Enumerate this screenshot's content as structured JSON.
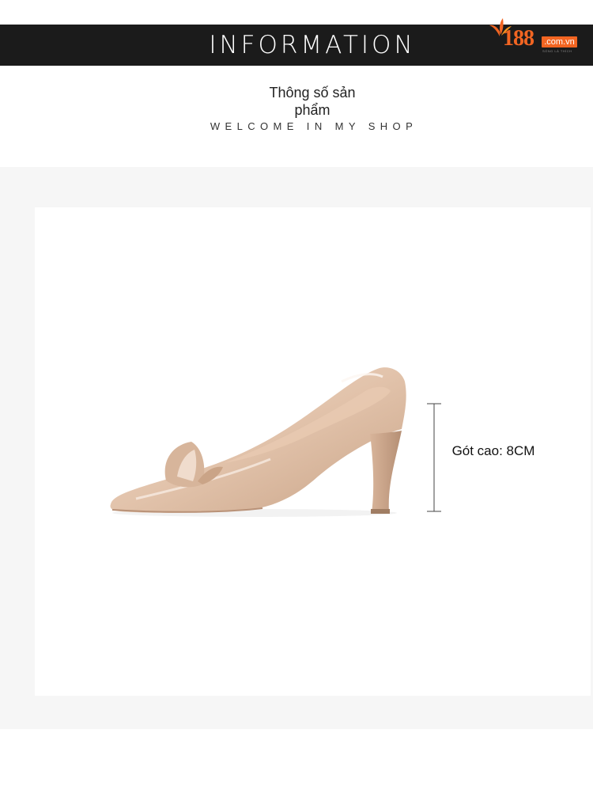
{
  "header": {
    "title": "INFORMATION"
  },
  "brand": {
    "number": "188",
    "domain": ".com.vn",
    "tagline": "SỐNG LÀ THÍCH",
    "accent_color": "#f26522"
  },
  "section": {
    "title": "Thông số sản phẩm",
    "subtitle": "WELCOME IN MY SHOP"
  },
  "product": {
    "image_icon": "high-heel-shoe",
    "heel_label": "Gót cao: 8CM"
  },
  "colors": {
    "header_bg": "#1b1b1b",
    "panel_bg": "#f6f6f6",
    "shoe_color": "#e3c4ad"
  }
}
